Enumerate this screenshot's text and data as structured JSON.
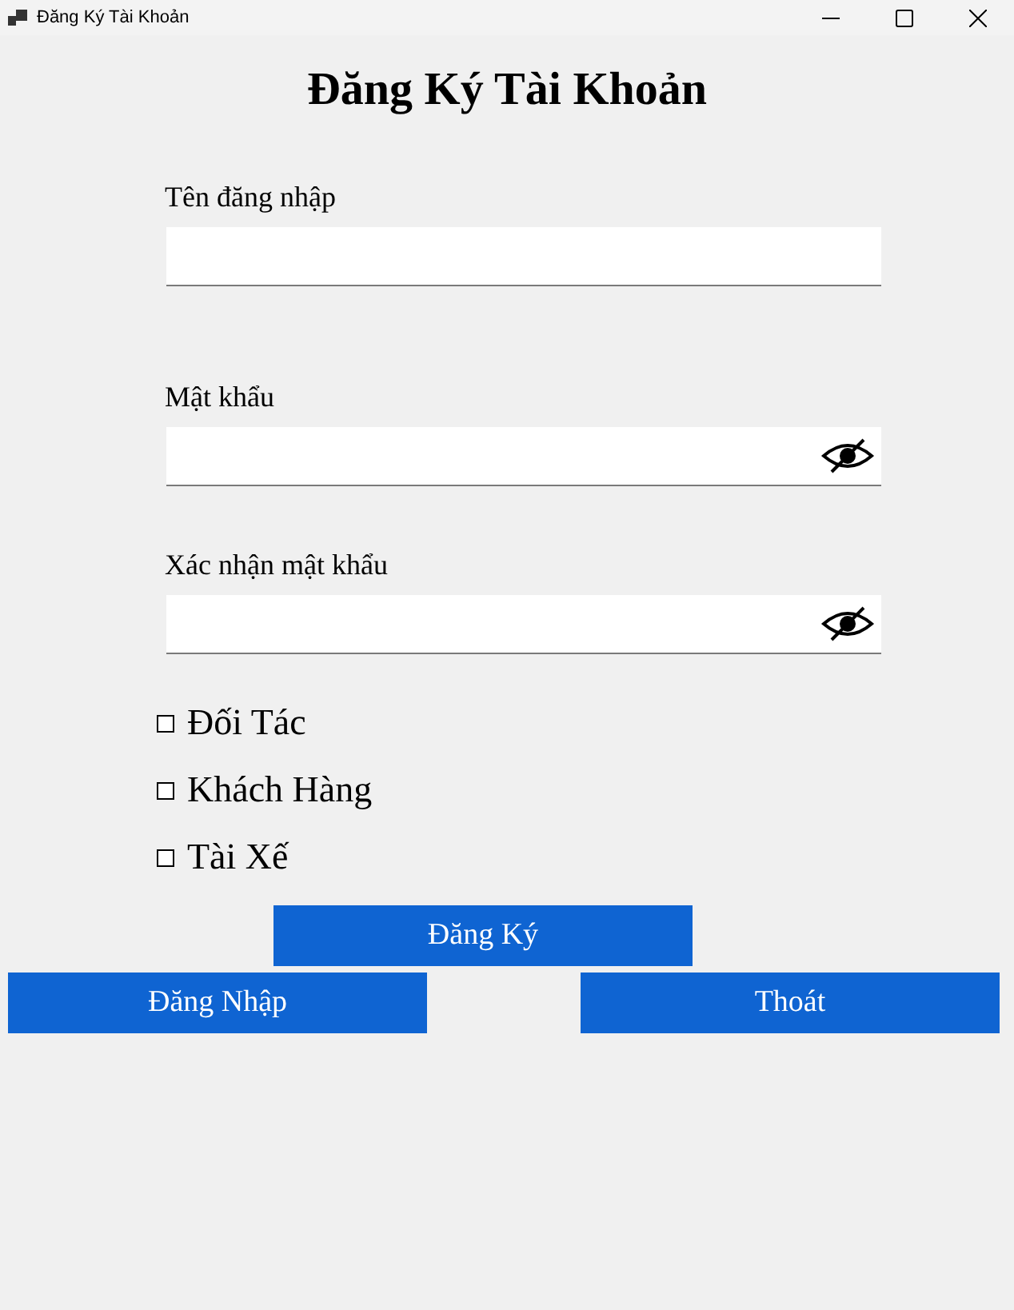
{
  "window": {
    "title": "Đăng Ký Tài Khoản"
  },
  "heading": "Đăng Ký Tài Khoản",
  "fields": [
    {
      "label": "Tên đăng nhập",
      "kind": "text"
    },
    {
      "label": "Mật khẩu",
      "kind": "password"
    },
    {
      "label": "Xác nhận mật khẩu",
      "kind": "password"
    }
  ],
  "roles": [
    {
      "label": "Đối Tác",
      "checked": false
    },
    {
      "label": "Khách Hàng",
      "checked": false
    },
    {
      "label": "Tài Xế",
      "checked": false
    }
  ],
  "buttons": {
    "register": "Đăng Ký",
    "login": "Đăng Nhập",
    "exit": "Thoát"
  }
}
